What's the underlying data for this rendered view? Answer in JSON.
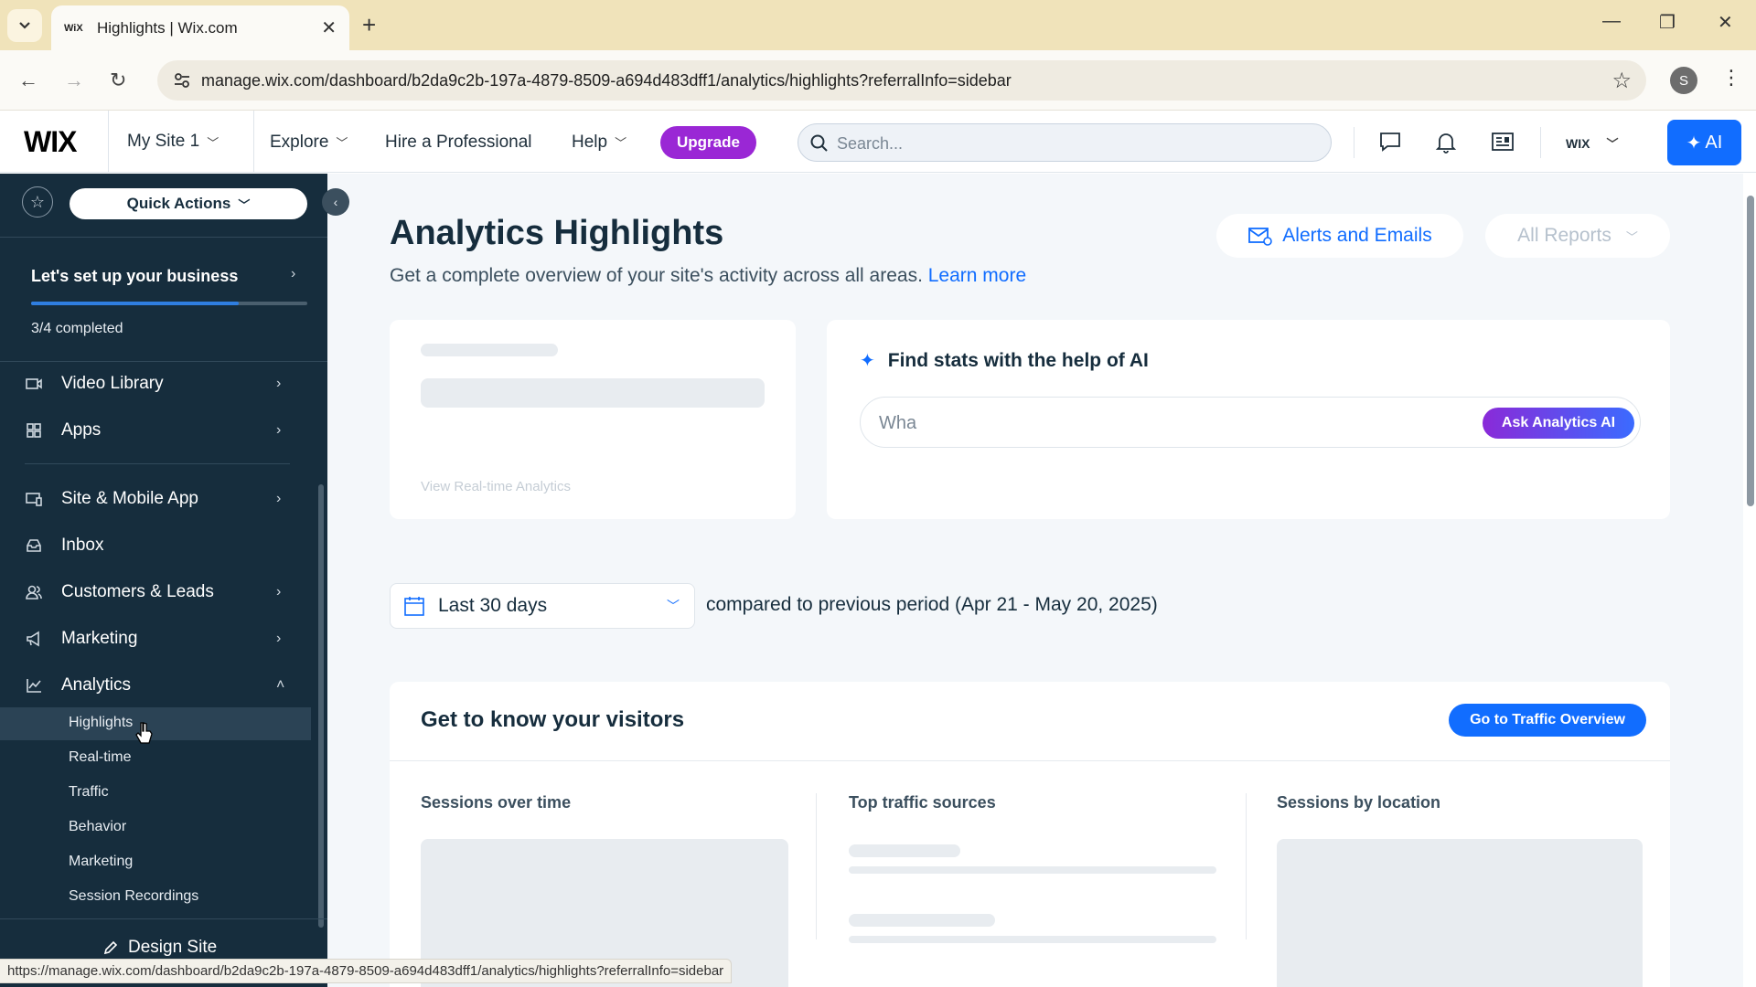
{
  "browser": {
    "tab_title": "Highlights | Wix.com",
    "tab_favicon": "WiX",
    "url": "manage.wix.com/dashboard/b2da9c2b-197a-4879-8509-a694d483dff1/analytics/highlights?referralInfo=sidebar",
    "profile_initial": "S",
    "status_url": "https://manage.wix.com/dashboard/b2da9c2b-197a-4879-8509-a694d483dff1/analytics/highlights?referralInfo=sidebar"
  },
  "topbar": {
    "logo": "WIX",
    "site_name": "My Site 1",
    "nav": {
      "explore": "Explore",
      "hire": "Hire a Professional",
      "help": "Help"
    },
    "upgrade_label": "Upgrade",
    "search_placeholder": "Search...",
    "account_label": "WIX",
    "ai_label": "AI"
  },
  "sidebar": {
    "quick_actions": "Quick Actions",
    "setup_title": "Let's set up your business",
    "setup_progress": 0.75,
    "setup_count": "3/4 completed",
    "items": [
      {
        "label": "Video Library",
        "icon": "video-icon"
      },
      {
        "label": "Apps",
        "icon": "apps-icon"
      },
      {
        "label": "Site & Mobile App",
        "icon": "site-icon"
      },
      {
        "label": "Inbox",
        "icon": "inbox-icon"
      },
      {
        "label": "Customers & Leads",
        "icon": "customers-icon"
      },
      {
        "label": "Marketing",
        "icon": "megaphone-icon"
      },
      {
        "label": "Analytics",
        "icon": "analytics-icon"
      }
    ],
    "analytics_sub": [
      "Highlights",
      "Real-time",
      "Traffic",
      "Behavior",
      "Marketing",
      "Session Recordings"
    ],
    "design_site": "Design Site"
  },
  "main": {
    "title": "Analytics Highlights",
    "subtitle": "Get a complete overview of your site's activity across all areas.",
    "learn_more": "Learn more",
    "alerts_label": "Alerts and Emails",
    "all_reports_label": "All Reports",
    "realtime_link": "View Real-time Analytics",
    "ai_title": "Find stats with the help of AI",
    "ai_input_value": "Wha",
    "ai_button": "Ask Analytics AI",
    "date_range": "Last 30 days",
    "compare_text": "compared to previous period (Apr 21 - May 20, 2025)",
    "visitors_title": "Get to know your visitors",
    "traffic_button": "Go to Traffic Overview",
    "columns": [
      "Sessions over time",
      "Top traffic sources",
      "Sessions by location"
    ]
  },
  "colors": {
    "wix_blue": "#116dff",
    "upgrade_purple": "#9a27d5",
    "sidebar_bg": "#162d3d",
    "browser_tab_bg": "#f0e3ba"
  }
}
